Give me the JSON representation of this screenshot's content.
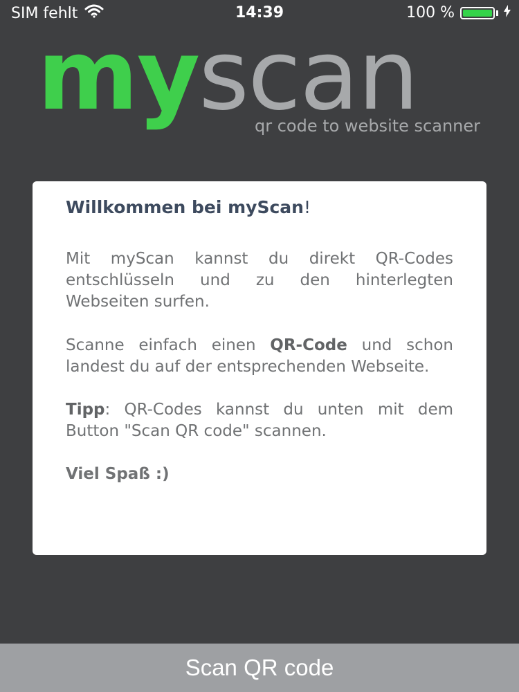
{
  "status_bar": {
    "carrier": "SIM fehlt",
    "time": "14:39",
    "battery_percent_text": "100 %",
    "battery_level": 1.0,
    "battery_color": "#34d34a"
  },
  "logo": {
    "my": "my",
    "scan": "scan",
    "tagline": "qr code to website scanner",
    "accent_color": "#3fcf4c"
  },
  "card": {
    "title_bold": "Willkommen bei myScan",
    "title_punct": "!",
    "p1": "Mit myScan kannst du direkt QR-Codes entschlüsseln und zu den hinterlegten Webseiten surfen.",
    "p2_before": "Scanne einfach einen ",
    "p2_bold": "QR-Code",
    "p2_after": " und schon landest du auf der entsprechenden Webseite.",
    "p3_bold": "Tipp",
    "p3_after": ": QR-Codes kannst du unten mit dem Button \"Scan QR code\" scannen.",
    "p4": "Viel Spaß :)"
  },
  "scan_button": {
    "label": "Scan QR code"
  }
}
